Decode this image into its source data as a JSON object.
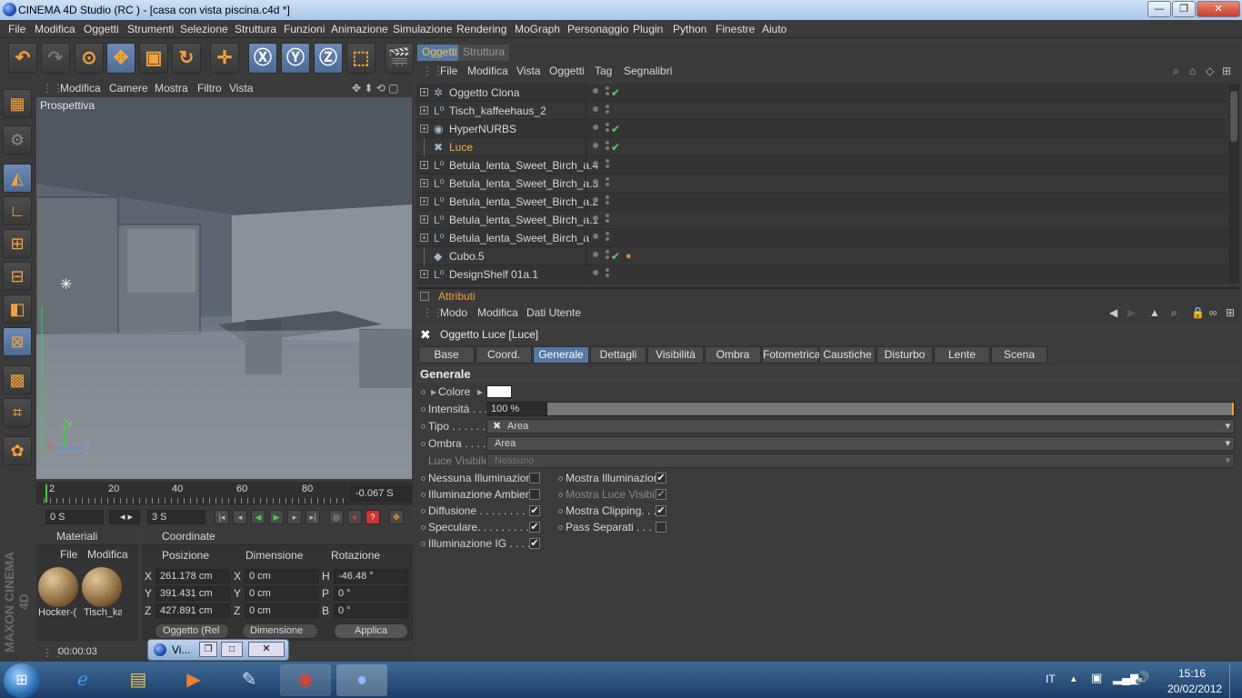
{
  "app": {
    "title": "CINEMA 4D Studio (RC ) - [casa con vista piscina.c4d *]"
  },
  "menu": [
    "File",
    "Modifica",
    "Oggetti",
    "Strumenti",
    "Selezione",
    "Struttura",
    "Funzioni",
    "Animazione",
    "Simulazione",
    "Rendering",
    "MoGraph",
    "Personaggio",
    "Plugin",
    "Python",
    "Finestre",
    "Aiuto"
  ],
  "viewport": {
    "menu": [
      "Modifica",
      "Camere",
      "Mostra",
      "Filtro",
      "Vista"
    ],
    "label": "Prospettiva",
    "axis_y": "Y",
    "axis_x": "X",
    "axis_z": "Z"
  },
  "timeline": {
    "ticks": [
      "2",
      "20",
      "40",
      "60",
      "80"
    ],
    "current": "-0.067 S",
    "start": "0 S",
    "end": "3 S"
  },
  "materials": {
    "header": "Materiali",
    "menu": [
      "File",
      "Modifica"
    ],
    "items": [
      "Hocker-(",
      "Tisch_ka"
    ]
  },
  "coords": {
    "header": "Coordinate",
    "cols": [
      "Posizione",
      "Dimensione",
      "Rotazione"
    ],
    "rows": [
      {
        "a": "X",
        "p": "261.178 cm",
        "b": "X",
        "d": "0 cm",
        "c": "H",
        "r": "-46.48 °"
      },
      {
        "a": "Y",
        "p": "391.431 cm",
        "b": "Y",
        "d": "0 cm",
        "c": "P",
        "r": "0 °"
      },
      {
        "a": "Z",
        "p": "427.891 cm",
        "b": "Z",
        "d": "0 cm",
        "c": "B",
        "r": "0 °"
      }
    ],
    "mode": "Oggetto (Rel",
    "dim": "Dimensione",
    "apply": "Applica"
  },
  "status": {
    "time": "00:00:03"
  },
  "objects": {
    "tabs": [
      "Oggetti",
      "Struttura"
    ],
    "menu": [
      "File",
      "Modifica",
      "Vista",
      "Oggetti",
      "Tag",
      "Segnalibri"
    ],
    "rows": [
      {
        "name": "Oggetto Clona",
        "ic": "✲",
        "chk": "✔",
        "exp": "+"
      },
      {
        "name": "Tisch_kaffeehaus_2",
        "ic": "L⁰",
        "chk": "",
        "exp": "+"
      },
      {
        "name": "HyperNURBS",
        "ic": "◉",
        "chk": "✔",
        "exp": "+"
      },
      {
        "name": "Luce",
        "ic": "✖",
        "chk": "✔",
        "exp": "",
        "active": true
      },
      {
        "name": "Betula_lenta_Sweet_Birch_a.4",
        "ic": "L⁰",
        "chk": "",
        "exp": "+"
      },
      {
        "name": "Betula_lenta_Sweet_Birch_a.3",
        "ic": "L⁰",
        "chk": "",
        "exp": "+"
      },
      {
        "name": "Betula_lenta_Sweet_Birch_a.2",
        "ic": "L⁰",
        "chk": "",
        "exp": "+"
      },
      {
        "name": "Betula_lenta_Sweet_Birch_a.1",
        "ic": "L⁰",
        "chk": "",
        "exp": "+"
      },
      {
        "name": "Betula_lenta_Sweet_Birch_a",
        "ic": "L⁰",
        "chk": "",
        "exp": "+"
      },
      {
        "name": "Cubo.5",
        "ic": "◆",
        "chk": "✔",
        "exp": ""
      },
      {
        "name": "DesignShelf 01a.1",
        "ic": "L⁰",
        "chk": "",
        "exp": "+"
      }
    ]
  },
  "attributes": {
    "header": "Attributi",
    "menu": [
      "Modo",
      "Modifica",
      "Dati Utente"
    ],
    "title": "Oggetto Luce [Luce]",
    "tabs": [
      "Base",
      "Coord.",
      "Generale",
      "Dettagli",
      "Visibilità",
      "Ombra",
      "Fotometrica",
      "Caustiche",
      "Disturbo",
      "Lente",
      "Scena"
    ],
    "selected_tab": "Generale",
    "section": "Generale",
    "colore": "Colore",
    "intensita": "Intensità . . .",
    "intensita_val": "100 %",
    "intensity_fraction": 1.0,
    "tipo": "Tipo . . . . . .",
    "tipo_val": "Area",
    "ombra": "Ombra . . . .",
    "ombra_val": "Area",
    "luce_vis": "Luce Visibile",
    "luce_vis_val": "Nessuno",
    "checks_left": [
      {
        "label": "Nessuna Illuminazione",
        "on": false
      },
      {
        "label": "Illuminazione Ambiente",
        "on": false
      },
      {
        "label": "Diffusione . . . . . . . . .",
        "on": true
      },
      {
        "label": "Speculare. . . . . . . . . .",
        "on": true
      },
      {
        "label": "Illuminazione IG . . . . .",
        "on": true
      }
    ],
    "checks_right": [
      {
        "label": "Mostra Illuminazione",
        "on": true
      },
      {
        "label": "Mostra Luce Visibile",
        "on": true,
        "disabled": true
      },
      {
        "label": "Mostra Clipping. . . .",
        "on": true
      },
      {
        "label": "Pass Separati . . . . .",
        "on": false
      }
    ]
  },
  "taskbar": {
    "lang": "IT",
    "time": "15:16",
    "date": "20/02/2012",
    "vi": "Vi..."
  },
  "brand": "MAXON CINEMA 4D",
  "colors": {
    "accent": "#f2a23a",
    "selected_tab": "#5577a3",
    "active_object": "#f5b035"
  }
}
